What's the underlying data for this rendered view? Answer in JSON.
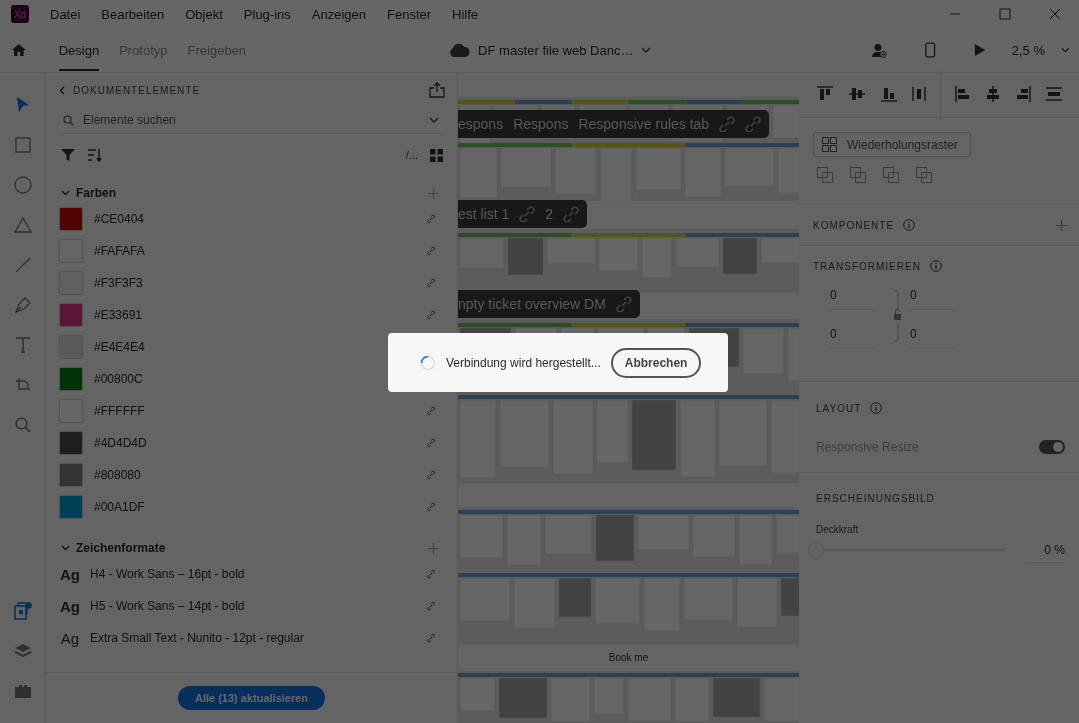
{
  "app": {
    "logo": "Xd"
  },
  "menu": [
    "Datei",
    "Bearbeiten",
    "Objekt",
    "Plug-ins",
    "Anzeigen",
    "Fenster",
    "Hilfe"
  ],
  "tabs": [
    {
      "label": "Design",
      "selected": true
    },
    {
      "label": "Prototyp",
      "selected": false
    },
    {
      "label": "Freigeben",
      "selected": false
    }
  ],
  "document": {
    "title": "DF master file web Danc…"
  },
  "zoom": "2,5 %",
  "tools": [
    {
      "kind": "select",
      "selected": true
    },
    {
      "kind": "rectangle",
      "selected": false
    },
    {
      "kind": "ellipse",
      "selected": false
    },
    {
      "kind": "polygon",
      "selected": false
    },
    {
      "kind": "line",
      "selected": false
    },
    {
      "kind": "pen",
      "selected": false
    },
    {
      "kind": "text",
      "selected": false
    },
    {
      "kind": "artboard",
      "selected": false
    },
    {
      "kind": "zoom",
      "selected": false
    }
  ],
  "bottom_tools": [
    {
      "kind": "assets",
      "selected": true,
      "badge": true
    },
    {
      "kind": "layers",
      "selected": false,
      "badge": false
    },
    {
      "kind": "plugins",
      "selected": false,
      "badge": false
    }
  ],
  "assets_panel": {
    "title": "DOKUMENTELEMENTE",
    "search": {
      "placeholder": "Elemente suchen"
    },
    "view_label": "/...",
    "colors": {
      "title": "Farben",
      "expanded": true,
      "items": [
        {
          "label": "#CE0404",
          "color": "#520202",
          "linked": true
        },
        {
          "label": "#FAFAFA",
          "color": "#646464",
          "linked": true
        },
        {
          "label": "#F3F3F3",
          "color": "#616161",
          "linked": true
        },
        {
          "label": "#E33691",
          "color": "#5b163a",
          "linked": true
        },
        {
          "label": "#E4E4E4",
          "color": "#5b5b5b"
        },
        {
          "label": "#00800C",
          "color": "#003305"
        },
        {
          "label": "#FFFFFF",
          "color": "#666666",
          "linked": true
        },
        {
          "label": "#4D4D4D",
          "color": "#1f1f1f",
          "linked": true
        },
        {
          "label": "#808080",
          "color": "#333333",
          "linked": true
        },
        {
          "label": "#00A1DF",
          "color": "#004059",
          "linked": true
        }
      ]
    },
    "char_styles": {
      "title": "Zeichenformate",
      "expanded": true,
      "items": [
        {
          "preview": "Ag",
          "label": "H4 - Work Sans – 16pt - bold",
          "bold": true
        },
        {
          "preview": "Ag",
          "label": "H5 - Work Sans – 14pt - bold",
          "bold": true
        },
        {
          "preview": "Ag",
          "label": "Extra Small Text - Nunito - 12pt - regular",
          "bold": false
        }
      ]
    },
    "update_button": "Alle (13) aktualisieren"
  },
  "canvas": {
    "chips": [
      {
        "items": [
          {
            "kind": "text",
            "label": "espons"
          },
          {
            "kind": "text",
            "label": "Respons"
          },
          {
            "kind": "text",
            "label": "Responsive rules tab"
          },
          {
            "kind": "link"
          },
          {
            "kind": "link"
          }
        ]
      },
      {
        "items": [
          {
            "kind": "text",
            "label": "est list 1"
          },
          {
            "kind": "link"
          },
          {
            "kind": "text",
            "label": "2"
          },
          {
            "kind": "link"
          }
        ]
      },
      {
        "items": [
          {
            "kind": "text",
            "label": "npty ticket overview DM"
          },
          {
            "kind": "link"
          }
        ]
      }
    ],
    "band_label": "Book me"
  },
  "properties": {
    "repeat_grid": "Wiederholungsraster",
    "component": {
      "title": "KOMPONENTE"
    },
    "transform": {
      "title": "TRANSFORMIEREN",
      "fields": [
        "0",
        "0",
        "0",
        "0"
      ]
    },
    "layout": {
      "title": "LAYOUT",
      "responsive_resize": {
        "label": "Responsive Resize",
        "on": true
      }
    },
    "appearance": {
      "title": "ERSCHEINUNGSBILD",
      "opacity": {
        "label": "Deckkraft",
        "level": 0,
        "reading": "0 %"
      }
    }
  },
  "dialog": {
    "message": "Verbindung wird hergestellt...",
    "cancel": "Abbrechen"
  }
}
